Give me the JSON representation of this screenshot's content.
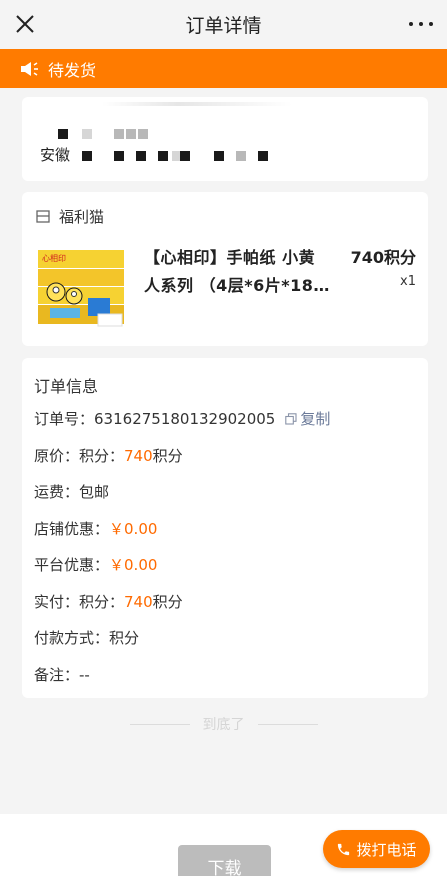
{
  "header": {
    "title": "订单详情",
    "close_icon": "close-icon",
    "more_icon": "more-dots-icon"
  },
  "status": {
    "text": "待发货",
    "icon": "speaker-icon",
    "color": "#ff7b00"
  },
  "address": {
    "name_prefix": "安徽"
  },
  "goods": {
    "shop_name": "福利猫",
    "shop_icon": "store-icon",
    "product_name": "【心相印】手帕纸 小黄人系列 （4层*6片*18…",
    "product_line1": "【心相印】手帕纸 小黄",
    "product_line2": "人系列 （4层*6片*18…",
    "price": "740积分",
    "quantity": "x1"
  },
  "order_info": {
    "heading": "订单信息",
    "order_no_label": "订单号：",
    "order_no": "6316275180132902005",
    "copy_label": "复制",
    "original_price_label": "原价：积分：",
    "original_price_value": "740",
    "original_price_unit": "积分",
    "shipping_label": "运费：",
    "shipping_value": "包邮",
    "shop_discount_label": "店铺优惠：",
    "shop_discount_value": "￥0.00",
    "platform_discount_label": "平台优惠：",
    "platform_discount_value": "￥0.00",
    "paid_label": "实付：积分：",
    "paid_value": "740",
    "paid_unit": "积分",
    "payment_method_label": "付款方式：",
    "payment_method_value": "积分",
    "remark_label": "备注：",
    "remark_value": "--"
  },
  "end_hint": "到底了",
  "footer": {
    "download_label": "下载",
    "call_label": "拨打电话",
    "call_icon": "phone-icon",
    "accent": "#ff7b00",
    "highlight": "#ff6a00"
  }
}
